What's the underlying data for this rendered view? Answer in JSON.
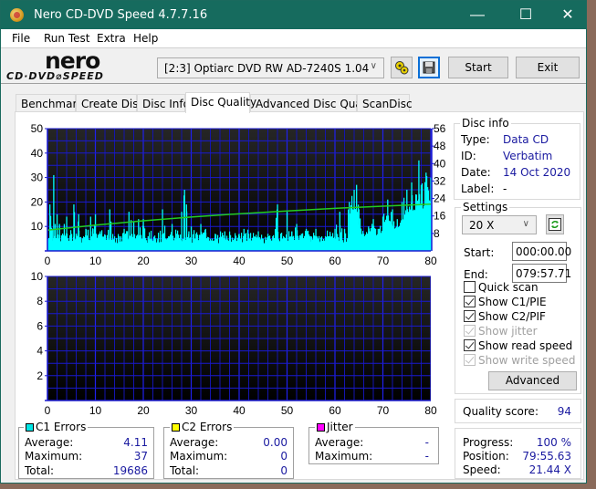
{
  "window": {
    "title": "Nero CD-DVD Speed 4.7.7.16",
    "controls": {
      "minimize": "—",
      "maximize": "☐",
      "close": "✕"
    }
  },
  "menu": [
    "File",
    "Run Test",
    "Extra",
    "Help"
  ],
  "toolbar": {
    "logo_top": "nero",
    "logo_bottom": "CD·DVD⌀SPEED",
    "drive": "[2:3]  Optiarc DVD RW AD-7240S 1.04",
    "start_label": "Start",
    "exit_label": "Exit"
  },
  "tabs": [
    {
      "label": "Benchmark",
      "active": false
    },
    {
      "label": "Create Disc",
      "active": false
    },
    {
      "label": "Disc Info",
      "active": false
    },
    {
      "label": "Disc Quality",
      "active": true
    },
    {
      "label": "Advanced Disc Quality",
      "active": false
    },
    {
      "label": "ScanDisc",
      "active": false
    }
  ],
  "disc_info": {
    "title": "Disc info",
    "type_label": "Type:",
    "type": "Data CD",
    "id_label": "ID:",
    "id": "Verbatim",
    "date_label": "Date:",
    "date": "14 Oct 2020",
    "label_label": "Label:",
    "label": "-"
  },
  "settings": {
    "title": "Settings",
    "speed": "20 X",
    "start_label": "Start:",
    "start": "000:00.00",
    "end_label": "End:",
    "end": "079:57.71",
    "checkboxes": [
      {
        "label": "Quick scan",
        "checked": false,
        "disabled": false
      },
      {
        "label": "Show C1/PIE",
        "checked": true,
        "disabled": false
      },
      {
        "label": "Show C2/PIF",
        "checked": true,
        "disabled": false
      },
      {
        "label": "Show jitter",
        "checked": true,
        "disabled": true
      },
      {
        "label": "Show read speed",
        "checked": true,
        "disabled": false
      },
      {
        "label": "Show write speed",
        "checked": true,
        "disabled": true
      }
    ],
    "advanced_label": "Advanced"
  },
  "quality": {
    "label": "Quality score:",
    "value": "94"
  },
  "progress": {
    "progress_label": "Progress:",
    "progress": "100 %",
    "position_label": "Position:",
    "position": "79:55.63",
    "speed_label": "Speed:",
    "speed": "21.44 X"
  },
  "stats": {
    "c1": {
      "title": "C1 Errors",
      "color": "#00e5e5",
      "avg_label": "Average:",
      "avg": "4.11",
      "max_label": "Maximum:",
      "max": "37",
      "total_label": "Total:",
      "total": "19686"
    },
    "c2": {
      "title": "C2 Errors",
      "color": "#ffff00",
      "avg_label": "Average:",
      "avg": "0.00",
      "max_label": "Maximum:",
      "max": "0",
      "total_label": "Total:",
      "total": "0"
    },
    "jitter": {
      "title": "Jitter",
      "color": "#ff00ff",
      "avg_label": "Average:",
      "avg": "-",
      "max_label": "Maximum:",
      "max": "-"
    }
  },
  "chart_data": [
    {
      "type": "bar",
      "title": "C1 Errors",
      "xlim": [
        0,
        80
      ],
      "ylim": [
        0,
        50
      ],
      "y2lim": [
        0,
        56
      ],
      "x_ticks": [
        "0",
        "10",
        "20",
        "30",
        "40",
        "50",
        "60",
        "70",
        "80"
      ],
      "y_ticks": [
        "10",
        "20",
        "30",
        "40",
        "50"
      ],
      "y2_ticks": [
        "8",
        "16",
        "24",
        "32",
        "40",
        "48",
        "56"
      ],
      "grid": true,
      "bar_color": "#00ffff",
      "c1_profile": [
        [
          0,
          4
        ],
        [
          0.5,
          19
        ],
        [
          1,
          9
        ],
        [
          1.3,
          31
        ],
        [
          1.6,
          11
        ],
        [
          2,
          15
        ],
        [
          2.5,
          11
        ],
        [
          3,
          6
        ],
        [
          3.5,
          11
        ],
        [
          4,
          14
        ],
        [
          5,
          5
        ],
        [
          5.5,
          19
        ],
        [
          6,
          7
        ],
        [
          6.5,
          15
        ],
        [
          7,
          5
        ],
        [
          8,
          9
        ],
        [
          9,
          14
        ],
        [
          9.5,
          9
        ],
        [
          10,
          15
        ],
        [
          11,
          8
        ],
        [
          12,
          4
        ],
        [
          13,
          17
        ],
        [
          14,
          4
        ],
        [
          15,
          6
        ],
        [
          16,
          9
        ],
        [
          17,
          16
        ],
        [
          18,
          12
        ],
        [
          19,
          13
        ],
        [
          20,
          13
        ],
        [
          21,
          6
        ],
        [
          22,
          4
        ],
        [
          23,
          5
        ],
        [
          24,
          17
        ],
        [
          25,
          5
        ],
        [
          26,
          11
        ],
        [
          27,
          7
        ],
        [
          28,
          16
        ],
        [
          28.6,
          25
        ],
        [
          29,
          19
        ],
        [
          29.5,
          8
        ],
        [
          30,
          10
        ],
        [
          31,
          7
        ],
        [
          32,
          11
        ],
        [
          33,
          9
        ],
        [
          34,
          5
        ],
        [
          35,
          7
        ],
        [
          36,
          4
        ],
        [
          37,
          8
        ],
        [
          38,
          6
        ],
        [
          39,
          5
        ],
        [
          40,
          7
        ],
        [
          41,
          9
        ],
        [
          42,
          7
        ],
        [
          43,
          6
        ],
        [
          44,
          8
        ],
        [
          45,
          5
        ],
        [
          46,
          7
        ],
        [
          47,
          6
        ],
        [
          48,
          19
        ],
        [
          49,
          5
        ],
        [
          50,
          16
        ],
        [
          51,
          8
        ],
        [
          52,
          11
        ],
        [
          53,
          7
        ],
        [
          54,
          9
        ],
        [
          55,
          6
        ],
        [
          56,
          9
        ],
        [
          57,
          4
        ],
        [
          58,
          6
        ],
        [
          59,
          7
        ],
        [
          60,
          9
        ],
        [
          61,
          16
        ],
        [
          62,
          9
        ],
        [
          63,
          20
        ],
        [
          64,
          25
        ],
        [
          64.5,
          27
        ],
        [
          65,
          17
        ],
        [
          66,
          7
        ],
        [
          67,
          10
        ],
        [
          68,
          13
        ],
        [
          69,
          9
        ],
        [
          70,
          14
        ],
        [
          71,
          21
        ],
        [
          72,
          17
        ],
        [
          73,
          13
        ],
        [
          74,
          20
        ],
        [
          75,
          25
        ],
        [
          76,
          28
        ],
        [
          77,
          23
        ],
        [
          77.5,
          37
        ],
        [
          78,
          27
        ],
        [
          79,
          32
        ],
        [
          80,
          30
        ]
      ],
      "read_speed_series": {
        "name": "Read speed (X)",
        "color": "#22cc22",
        "x": [
          0,
          10,
          20,
          30,
          40,
          50,
          60,
          70,
          80
        ],
        "y": [
          9.5,
          11.8,
          13.8,
          15.5,
          17.0,
          18.3,
          19.5,
          20.5,
          21.4
        ]
      }
    },
    {
      "type": "bar",
      "title": "C2 Errors",
      "xlim": [
        0,
        80
      ],
      "ylim": [
        0,
        10
      ],
      "x_ticks": [
        "0",
        "10",
        "20",
        "30",
        "40",
        "50",
        "60",
        "70",
        "80"
      ],
      "y_ticks": [
        "2",
        "4",
        "6",
        "8",
        "10"
      ],
      "grid": true,
      "values": []
    }
  ]
}
